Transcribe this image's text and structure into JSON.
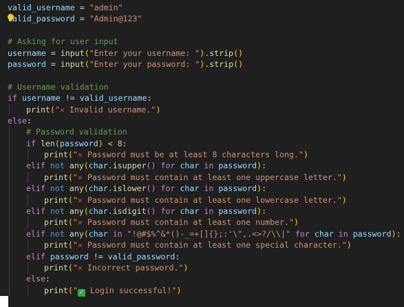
{
  "editor": {
    "language": "python",
    "theme_colors": {
      "background": "#1f1f1f",
      "variable": "#9cdcfe",
      "string": "#ce9178",
      "comment": "#6a9955",
      "keyword": "#569cd6",
      "control": "#c586c0",
      "function": "#dcdcaa",
      "number": "#b5cea8"
    },
    "lightbulb_icon": "lightbulb-icon",
    "lines": [
      [
        "valid_username",
        " = ",
        "\"admin\""
      ],
      [
        "valid_password",
        " = ",
        "\"Admin@123\""
      ],
      [],
      [
        "# Asking for user input"
      ],
      [
        "username",
        " = ",
        "input",
        "(",
        "\"Enter your username: \"",
        ").",
        "strip",
        "()"
      ],
      [
        "password",
        " = ",
        "input",
        "(",
        "\"Enter your password: \"",
        ").",
        "strip",
        "()"
      ],
      [],
      [
        "# Username validation"
      ],
      [
        "if",
        " ",
        "username",
        " != ",
        "valid_username",
        ":"
      ],
      [
        "print",
        "(",
        "\"",
        "✕",
        " Invalid username.\"",
        ")"
      ],
      [
        "else",
        ":"
      ],
      [
        "# Password validation"
      ],
      [
        "if",
        " ",
        "len",
        "(",
        "password",
        ") < ",
        "8",
        ":"
      ],
      [
        "print",
        "(",
        "\"",
        "✕",
        " Password must be at least 8 characters long.\"",
        ")"
      ],
      [
        "elif",
        " ",
        "not",
        " ",
        "any",
        "(",
        "char",
        ".",
        "isupper",
        "() ",
        "for",
        " ",
        "char",
        " ",
        "in",
        " ",
        "password",
        "):"
      ],
      [
        "print",
        "(",
        "\"",
        "✕",
        " Password must contain at least one uppercase letter.\"",
        ")"
      ],
      [
        "elif",
        " ",
        "not",
        " ",
        "any",
        "(",
        "char",
        ".",
        "islower",
        "() ",
        "for",
        " ",
        "char",
        " ",
        "in",
        " ",
        "password",
        "):"
      ],
      [
        "print",
        "(",
        "\"",
        "✕",
        " Password must contain at least one lowercase letter.\"",
        ")"
      ],
      [
        "elif",
        " ",
        "not",
        " ",
        "any",
        "(",
        "char",
        ".",
        "isdigit",
        "() ",
        "for",
        " ",
        "char",
        " ",
        "in",
        " ",
        "password",
        "):"
      ],
      [
        "print",
        "(",
        "\"",
        "✕",
        " Password must contain at least one number.\"",
        ")"
      ],
      [
        "elif",
        " ",
        "not",
        " ",
        "any",
        "(",
        "char",
        " ",
        "in",
        " ",
        "\"!@#$%^&*()-_=+[]{};:'\\\",.<>?/\\\\|\"",
        " ",
        "for",
        " ",
        "char",
        " ",
        "in",
        " ",
        "password",
        "):"
      ],
      [
        "print",
        "(",
        "\"",
        "✕",
        " Password must contain at least one special character.\"",
        ")"
      ],
      [
        "elif",
        " ",
        "password",
        " != ",
        "valid_password",
        ":"
      ],
      [
        "print",
        "(",
        "\"",
        "✕",
        " Incorrect password.\"",
        ")"
      ],
      [
        "else",
        ":"
      ],
      [
        "print",
        "(",
        "\"",
        "✓",
        " Login successful!\"",
        ")"
      ]
    ]
  }
}
